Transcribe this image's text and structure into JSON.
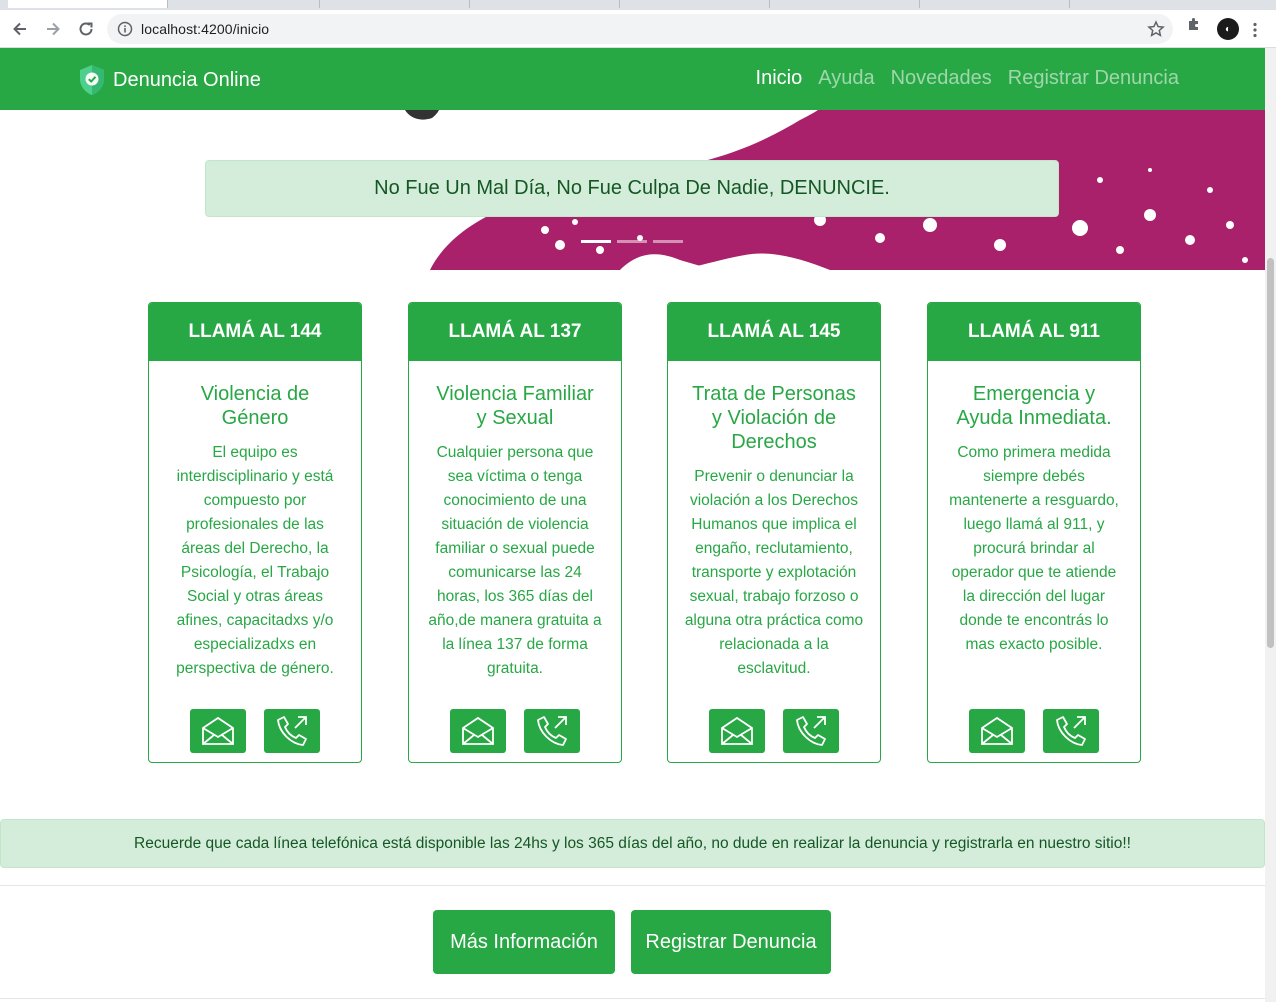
{
  "browser": {
    "url": "localhost:4200/inicio"
  },
  "navbar": {
    "brand": "Denuncia Online",
    "links": [
      {
        "label": "Inicio"
      },
      {
        "label": "Ayuda"
      },
      {
        "label": "Novedades"
      },
      {
        "label": "Registrar Denuncia"
      }
    ],
    "active_link": "Inicio"
  },
  "carousel": {
    "caption": "No Fue Un Mal Día, No Fue Culpa De Nadie, DENUNCIE.",
    "slides_count": 3,
    "active_slide": 1
  },
  "cards": [
    {
      "header": "LLAMÁ AL 144",
      "title": "Violencia de Género",
      "text": "El equipo es interdisciplinario y está compuesto por profesionales de las áreas del Derecho, la Psicología, el Trabajo Social y otras áreas afines, capacitadxs y/o especializadxs en perspectiva de género.",
      "icons": [
        "envelope-icon",
        "phone-outgoing-icon"
      ]
    },
    {
      "header": "LLAMÁ AL 137",
      "title": "Violencia Familiar y Sexual",
      "text": "Cualquier persona que sea víctima o tenga conocimiento de una situación de violencia familiar o sexual puede comunicarse las 24 horas, los 365 días del año,de manera gratuita a la línea 137 de forma gratuita.",
      "icons": [
        "envelope-icon",
        "phone-outgoing-icon"
      ]
    },
    {
      "header": "LLAMÁ AL 145",
      "title": "Trata de Personas y Violación de Derechos",
      "text": "Prevenir o denunciar la violación a los Derechos Humanos que implica el engaño, reclutamiento, transporte y explotación sexual, trabajo forzoso o alguna otra práctica como relacionada a la esclavitud.",
      "icons": [
        "envelope-icon",
        "phone-outgoing-icon"
      ]
    },
    {
      "header": "LLAMÁ AL 911",
      "title": "Emergencia y Ayuda Inmediata.",
      "text": "Como primera medida siempre debés mantenerte a resguardo, luego llamá al 911, y procurá brindar al operador que te atiende la dirección del lugar donde te encontrás lo mas exacto posible.",
      "icons": [
        "envelope-icon",
        "phone-outgoing-icon"
      ]
    }
  ],
  "notice": "Recuerde que cada línea telefónica está disponible las 24hs y los 365 días del año, no dude en realizar la denuncia y registrarla en nuestro sitio!!",
  "buttons": {
    "more_info": "Más Información",
    "register": "Registrar Denuncia"
  },
  "colors": {
    "primary": "#28a745",
    "alert_bg": "#d4edda",
    "alert_text": "#155724",
    "carousel_magenta": "#a8216a"
  }
}
